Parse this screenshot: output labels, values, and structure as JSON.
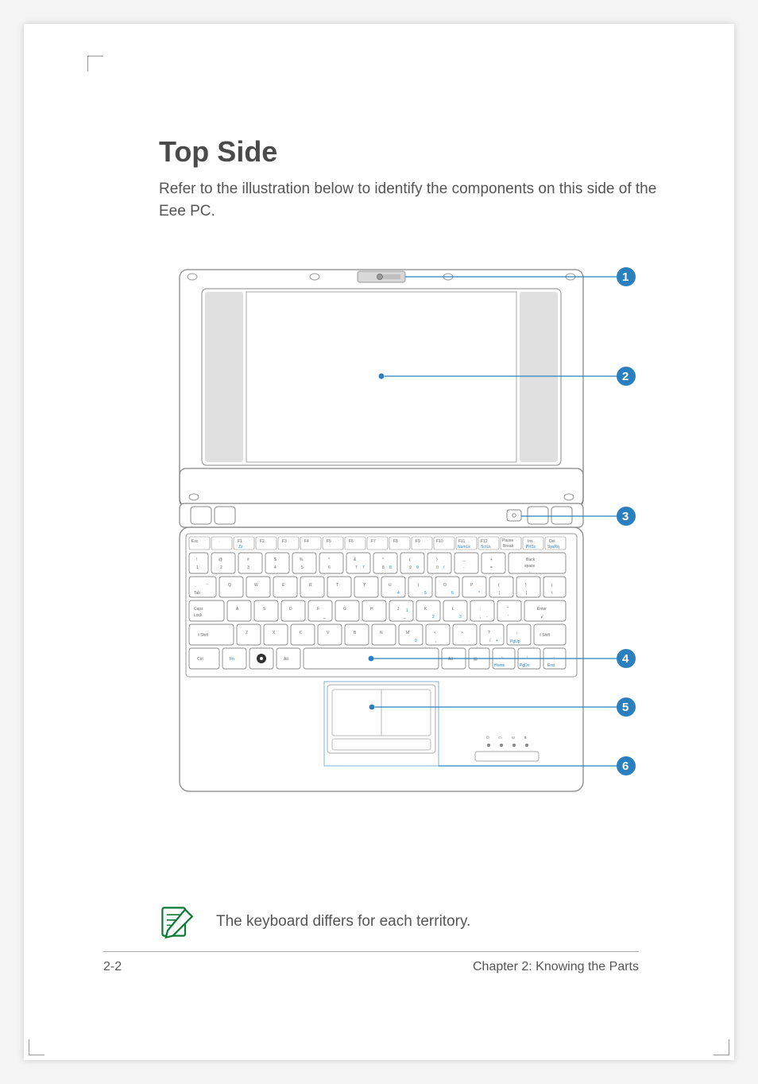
{
  "title": "Top Side",
  "intro": "Refer to the illustration below to identify the components on this side of the Eee PC.",
  "callouts": {
    "c1": "1",
    "c2": "2",
    "c3": "3",
    "c4": "4",
    "c5": "5",
    "c6": "6"
  },
  "note": "The keyboard differs for each territory.",
  "footer": {
    "left": "2-2",
    "right": "Chapter 2: Knowing the Parts"
  },
  "keyboard": {
    "row0": [
      "Esc",
      "~\n`",
      "F1",
      "F2",
      "F3",
      "F4",
      "F5",
      "F6",
      "F7",
      "F8",
      "F9",
      "F10",
      "F11",
      "F12",
      "Pause\nBreak",
      "Ins",
      "Del"
    ],
    "row1": [
      "!\n1",
      "@\n2",
      "#\n3",
      "$\n4",
      "%\n5",
      "^\n6",
      "&\n7",
      "*\n8",
      "(\n9",
      ")\n0",
      "_\n-",
      "+\n=",
      "Back\nspace"
    ],
    "row2": [
      "Tab",
      "Q",
      "W",
      "E",
      "R",
      "T",
      "Y",
      "U",
      "I",
      "O",
      "P",
      "{\n[",
      "}\n]",
      "|\n\\"
    ],
    "row3": [
      "Caps\nLock",
      "A",
      "S",
      "D",
      "F",
      "G",
      "H",
      "J",
      "K",
      "L",
      ":\n;",
      "\"\n'",
      "Enter"
    ],
    "row4": [
      "Shift",
      "Z",
      "X",
      "C",
      "V",
      "B",
      "N",
      "M",
      "<\n,",
      ">\n.",
      "?\n/",
      "↑",
      "Shift"
    ],
    "row5": [
      "Ctrl",
      "Fn",
      "",
      "Alt",
      "",
      "Alt",
      "",
      "←",
      "↓",
      "→"
    ],
    "fnSecondary": {
      "F1": "Zz",
      "F2": "",
      "F3": "",
      "F4": "",
      "F5": "",
      "F6": "",
      "F7": "",
      "F8": "",
      "F9": "",
      "F10": "",
      "F11": "NumLk",
      "F12": "ScrLk",
      "Ins": "PrtSc",
      "Del": "SysRq",
      "U": "4",
      "I": "5",
      "O": "6",
      "P": "*",
      "J": "1",
      "K": "2",
      "L": "3",
      "M": "0",
      "up": "PgUp",
      "left": "Home",
      "down": "PgDn",
      "right": "End"
    }
  },
  "indicatorIcons": [
    "power",
    "battery",
    "disk",
    "wifi"
  ]
}
